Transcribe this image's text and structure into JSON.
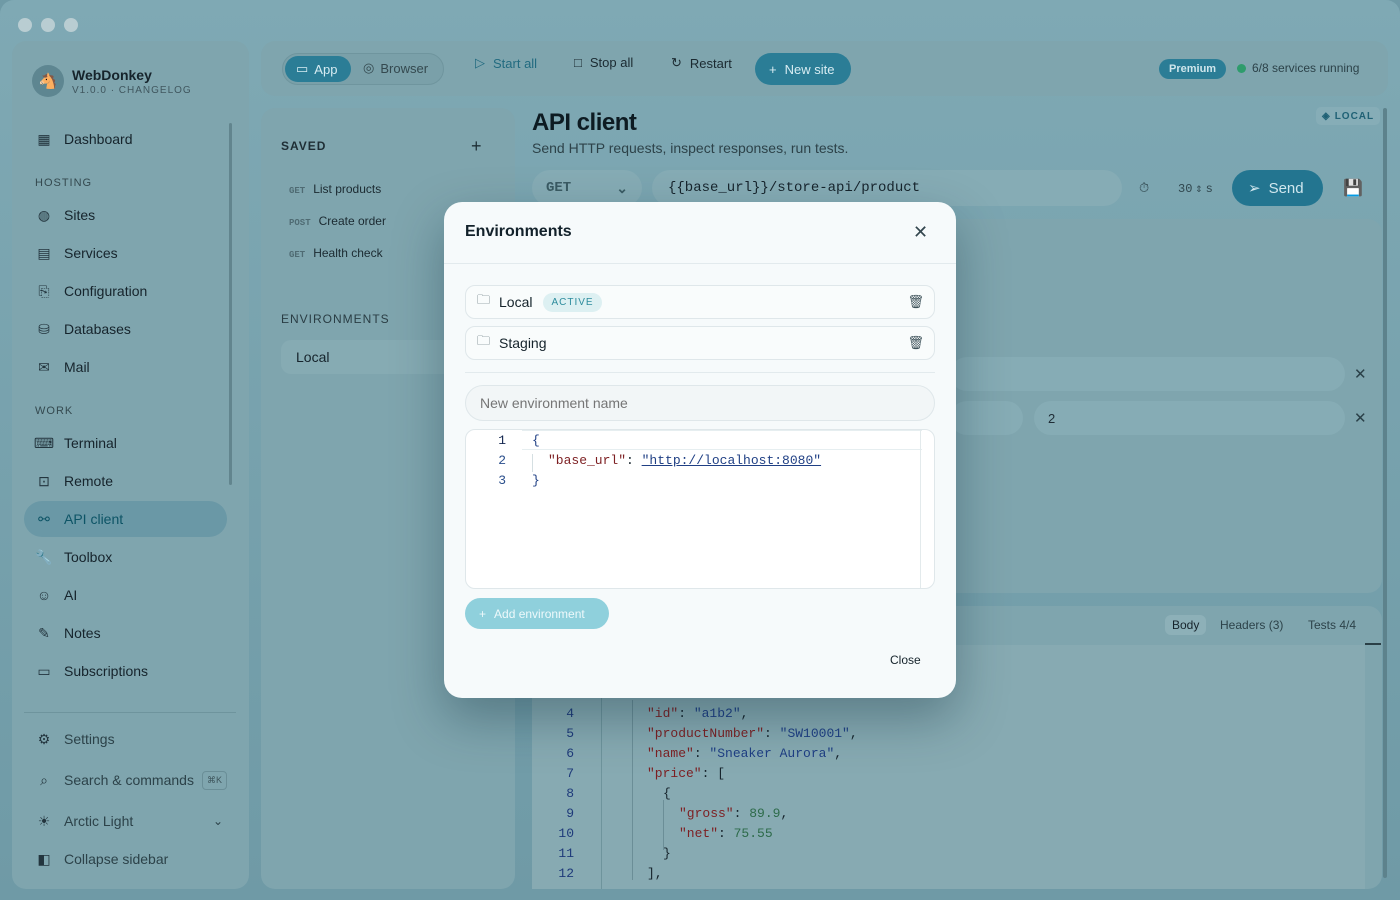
{
  "brand": {
    "name": "WebDonkey",
    "version": "V1.0.0 · CHANGELOG"
  },
  "sidebar": {
    "dashboard": "Dashboard",
    "hosting_label": "HOSTING",
    "hosting": [
      "Sites",
      "Services",
      "Configuration",
      "Databases",
      "Mail"
    ],
    "work_label": "WORK",
    "work": [
      "Terminal",
      "Remote",
      "API client",
      "Toolbox",
      "AI",
      "Notes",
      "Subscriptions"
    ],
    "settings": "Settings",
    "search": "Search & commands",
    "search_kbd": "⌘K",
    "theme": "Arctic Light",
    "collapse": "Collapse sidebar"
  },
  "topbar": {
    "app": "App",
    "browser": "Browser",
    "start_all": "Start all",
    "stop_all": "Stop all",
    "restart": "Restart",
    "new_site": "New site",
    "premium": "Premium",
    "status": "6/8 services running"
  },
  "saved": {
    "title": "SAVED",
    "requests": [
      {
        "method": "GET",
        "name": "List products"
      },
      {
        "method": "POST",
        "name": "Create order"
      },
      {
        "method": "GET",
        "name": "Health check"
      }
    ],
    "env_title": "ENVIRONMENTS",
    "env_active": "Local"
  },
  "main": {
    "title": "API client",
    "subtitle": "Send HTTP requests, inspect responses, run tests.",
    "env_badge": "LOCAL",
    "method": "GET",
    "url": "{{base_url}}/store-api/product",
    "timeout": "30",
    "timeout_unit": "s",
    "send": "Send",
    "kv_value": "2"
  },
  "response": {
    "tabs": [
      "Body",
      "Headers (3)",
      "Tests 4/4"
    ],
    "lines": [
      {
        "n": "4",
        "html": "<span class='k'>\"id\"</span>: <span class='s'>\"a1b2\"</span>,",
        "indent": 647
      },
      {
        "n": "5",
        "html": "<span class='k'>\"productNumber\"</span>: <span class='s'>\"SW10001\"</span>,",
        "indent": 647
      },
      {
        "n": "6",
        "html": "<span class='k'>\"name\"</span>: <span class='s'>\"Sneaker Aurora\"</span>,",
        "indent": 647
      },
      {
        "n": "7",
        "html": "<span class='k'>\"price\"</span>: [",
        "indent": 647
      },
      {
        "n": "8",
        "html": "{",
        "indent": 663
      },
      {
        "n": "9",
        "html": "<span class='k'>\"gross\"</span>: <span class='n'>89.9</span>,",
        "indent": 679
      },
      {
        "n": "10",
        "html": "<span class='k'>\"net\"</span>: <span class='n'>75.55</span>",
        "indent": 679
      },
      {
        "n": "11",
        "html": "}",
        "indent": 663
      },
      {
        "n": "12",
        "html": "],",
        "indent": 647
      }
    ]
  },
  "modal": {
    "title": "Environments",
    "envs": [
      {
        "name": "Local",
        "badge": "ACTIVE"
      },
      {
        "name": "Staging",
        "badge": ""
      }
    ],
    "new_placeholder": "New environment name",
    "editor": {
      "key": "\"base_url\"",
      "value": "\"http://localhost:8080\""
    },
    "add": "Add environment",
    "close": "Close"
  }
}
